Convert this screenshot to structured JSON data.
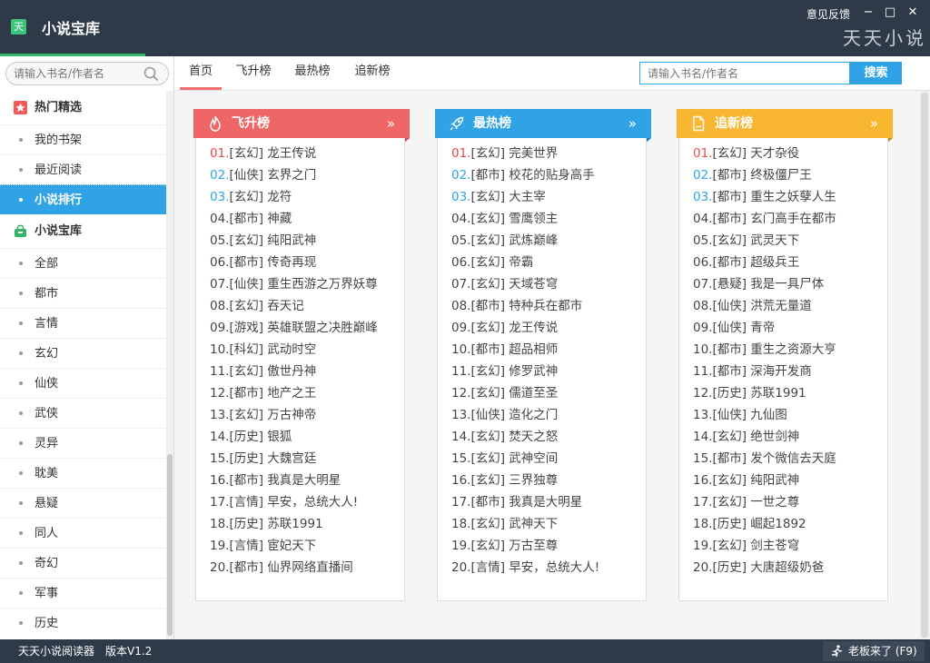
{
  "app": {
    "icon_text": "天",
    "title": "小说宝库",
    "feedback": "意见反馈",
    "brand": "天天小说"
  },
  "window_controls": {
    "minimize": "−",
    "maximize": "□",
    "close": "✕"
  },
  "sidebar": {
    "search_placeholder": "请输入书名/作者名",
    "sections": [
      {
        "title": "热门精选",
        "icon": "star-badge-icon",
        "items": [
          "我的书架",
          "最近阅读",
          "小说排行"
        ]
      },
      {
        "title": "小说宝库",
        "icon": "book-basket-icon",
        "items": [
          "全部",
          "都市",
          "言情",
          "玄幻",
          "仙侠",
          "武侠",
          "灵异",
          "耽美",
          "悬疑",
          "同人",
          "奇幻",
          "军事",
          "历史"
        ]
      }
    ],
    "active_item": "小说排行"
  },
  "tabs": [
    "首页",
    "飞升榜",
    "最热榜",
    "追新榜"
  ],
  "active_tab": "首页",
  "top_search": {
    "placeholder": "请输入书名/作者名",
    "button": "搜索"
  },
  "panels": [
    {
      "title": "飞升榜",
      "icon": "flame-icon",
      "color": "#ef6666",
      "more": "»",
      "items": [
        "01.[玄幻] 龙王传说",
        "02.[仙侠] 玄界之门",
        "03.[玄幻] 龙符",
        "04.[都市] 神藏",
        "05.[玄幻] 纯阳武神",
        "06.[都市] 传奇再现",
        "07.[仙侠] 重生西游之万界妖尊",
        "08.[玄幻] 吞天记",
        "09.[游戏] 英雄联盟之决胜巅峰",
        "10.[科幻] 武动时空",
        "11.[玄幻] 傲世丹神",
        "12.[都市] 地产之王",
        "13.[玄幻] 万古神帝",
        "14.[历史] 银狐",
        "15.[历史] 大魏宫廷",
        "16.[都市] 我真是大明星",
        "17.[言情] 早安，总统大人!",
        "18.[历史] 苏联1991",
        "19.[言情] 宦妃天下",
        "20.[都市] 仙界网络直播间"
      ]
    },
    {
      "title": "最热榜",
      "icon": "rocket-icon",
      "color": "#2fa3e6",
      "more": "»",
      "items": [
        "01.[玄幻] 完美世界",
        "02.[都市] 校花的贴身高手",
        "03.[玄幻] 大主宰",
        "04.[玄幻] 雪鹰领主",
        "05.[玄幻] 武炼巅峰",
        "06.[玄幻] 帝霸",
        "07.[玄幻] 天域苍穹",
        "08.[都市] 特种兵在都市",
        "09.[玄幻] 龙王传说",
        "10.[都市] 超品相师",
        "11.[玄幻] 修罗武神",
        "12.[玄幻] 儒道至圣",
        "13.[仙侠] 造化之门",
        "14.[玄幻] 焚天之怒",
        "15.[玄幻] 武神空间",
        "16.[玄幻] 三界独尊",
        "17.[都市] 我真是大明星",
        "18.[玄幻] 武神天下",
        "19.[玄幻] 万古至尊",
        "20.[言情] 早安，总统大人!"
      ]
    },
    {
      "title": "追新榜",
      "icon": "document-icon",
      "color": "#f8b631",
      "more": "»",
      "items": [
        "01.[玄幻] 天才杂役",
        "02.[都市] 终极僵尸王",
        "03.[都市] 重生之妖孽人生",
        "04.[都市] 玄门高手在都市",
        "05.[玄幻] 武灵天下",
        "06.[都市] 超级兵王",
        "07.[悬疑] 我是一具尸体",
        "08.[仙侠] 洪荒无量道",
        "09.[仙侠] 青帝",
        "10.[都市] 重生之资源大亨",
        "11.[都市] 深海开发商",
        "12.[历史] 苏联1991",
        "13.[仙侠] 九仙图",
        "14.[玄幻] 绝世剑神",
        "15.[都市] 发个微信去天庭",
        "16.[玄幻] 纯阳武神",
        "17.[玄幻] 一世之尊",
        "18.[历史] 崛起1892",
        "19.[玄幻] 剑主苍穹",
        "20.[历史] 大唐超级奶爸"
      ]
    }
  ],
  "statusbar": {
    "app_name": "天天小说阅读器",
    "version": "版本V1.2",
    "boss_key": "老板来了 (F9)"
  }
}
